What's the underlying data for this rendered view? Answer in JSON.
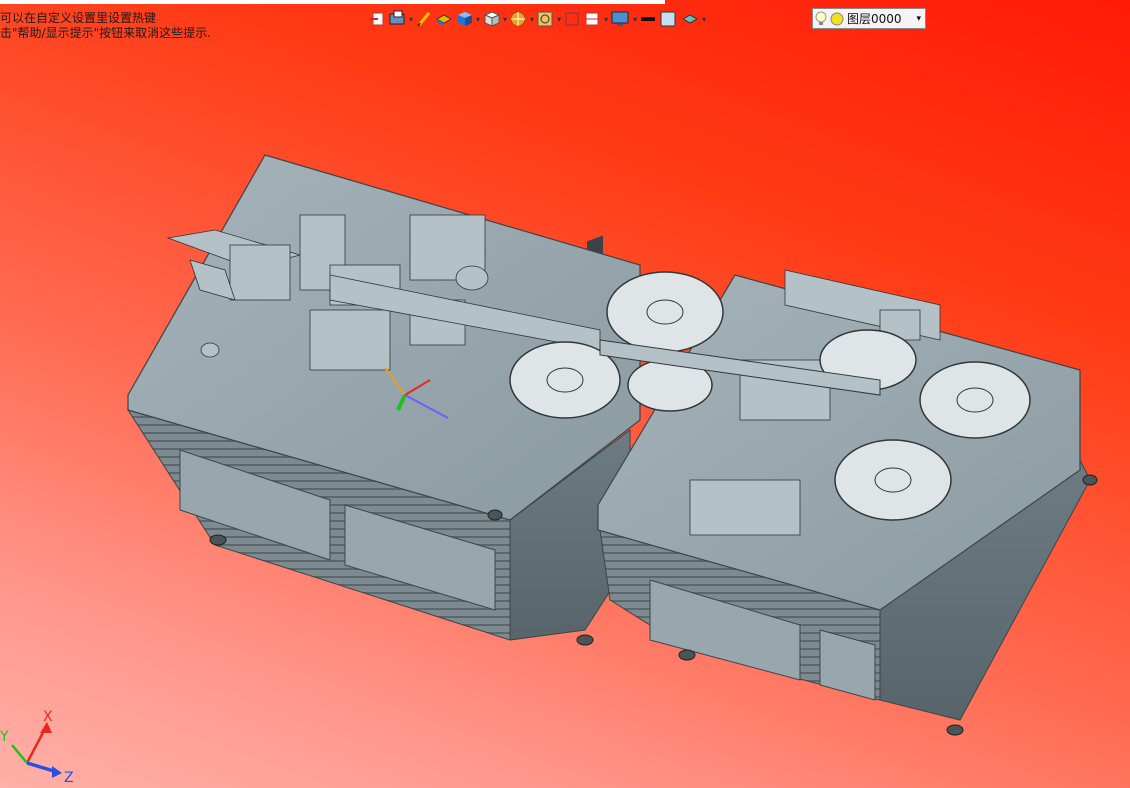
{
  "hint": {
    "line1": "可以在自定义设置里设置热键",
    "line2": "击\"帮助/显示提示\"按钮来取消这些提示."
  },
  "toolbar": {
    "layer_label": "图层0000",
    "icons": [
      "exit-sketch-icon",
      "render-mode-icon",
      "pen-icon",
      "solid-box-icon",
      "view-cube-icon",
      "white-cube-icon",
      "section-icon",
      "zoom-icon",
      "frame-icon",
      "split-icon",
      "display-icon",
      "line-color-icon",
      "fill-color-icon",
      "material-icon",
      "light-bulb-icon",
      "layer-color-icon"
    ]
  },
  "axes": {
    "x": "X",
    "y": "Y",
    "z": "Z"
  },
  "colors": {
    "accent_x": "#e8281e",
    "accent_y": "#20c020",
    "accent_z": "#2a4fe0",
    "model_metal": "#8f9ea5"
  }
}
